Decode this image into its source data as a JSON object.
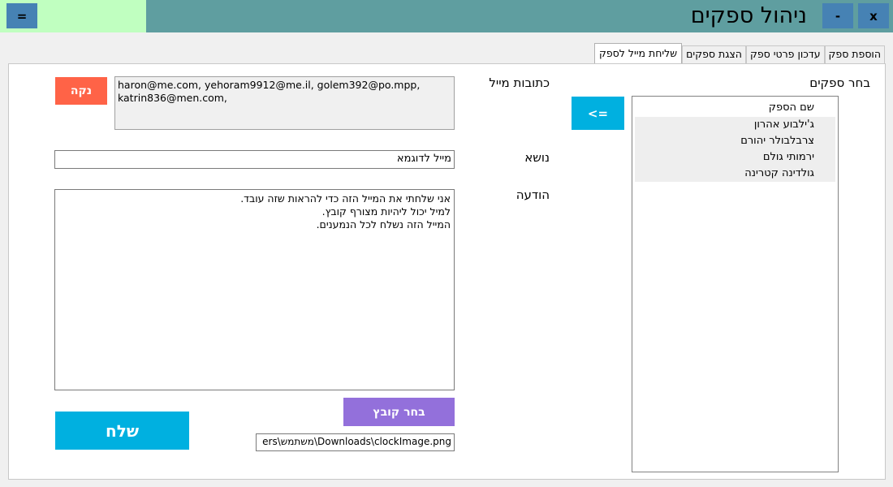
{
  "window": {
    "title": "ניהול ספקים",
    "menu_label": "=",
    "minimize_label": "-",
    "close_label": "x"
  },
  "colors": {
    "titlebar": "#5f9ea0",
    "titlebar_light": "#c0ffc0",
    "window_buttons": "#4682b4",
    "send_button": "#00b0e0",
    "clear_button": "#ff6347",
    "file_button": "#9370db"
  },
  "tabs": [
    {
      "label": "הוספת ספק",
      "active": false
    },
    {
      "label": "עדכון פרטי ספק",
      "active": false
    },
    {
      "label": "הצגת ספקים",
      "active": false
    },
    {
      "label": "שליחת מייל לספק",
      "active": true
    }
  ],
  "suppliers": {
    "label": "בחר ספקים",
    "column_header": "שם הספק",
    "items": [
      "ג'ילבוע אהרון",
      "צרבלבולר יהורם",
      "ירמותי גולם",
      "גולדינה קטרינה"
    ],
    "add_button_label": "<="
  },
  "form": {
    "emails_label": "כתובות מייל",
    "emails_line1": "haron@me.com, yehoram9912@me.il, golem392@po.mpp,",
    "emails_line2": "katrin836@men.com,",
    "clear_button_label": "נקה",
    "subject_label": "נושא",
    "subject_value": "מייל לדוגמא",
    "message_label": "הודעה",
    "message_lines": [
      "אני שלחתי את המייל הזה כדי להראות שזה עובד.",
      "למיל יכול ליהיות מצורף קובץ.",
      "המייל הזה נשלח לכל הנמענים."
    ],
    "choose_file_label": "בחר קובץ",
    "file_path": "ers\\משתמש\\Downloads\\clockImage.png",
    "send_button_label": "שלח"
  }
}
